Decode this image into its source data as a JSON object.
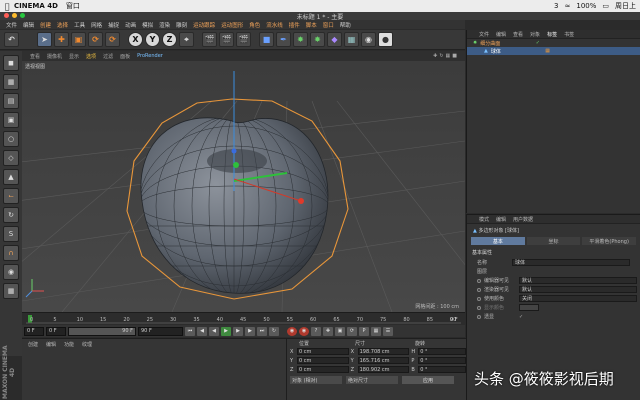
{
  "mac": {
    "app_name": "CINEMA 4D",
    "menu_window": "窗口",
    "battery": "100%",
    "time": "周日上",
    "badge_count": "3"
  },
  "window": {
    "title": "未标题 1 * - 主要"
  },
  "menubar": [
    "文件",
    "编辑",
    "创建",
    "选择",
    "工具",
    "网格",
    "捕捉",
    "动画",
    "模拟",
    "渲染",
    "雕刻",
    "运动跟踪",
    "运动图形",
    "角色",
    "流水线",
    "插件",
    "脚本",
    "窗口",
    "帮助"
  ],
  "viewport": {
    "menu": [
      "查看",
      "摄像机",
      "显示",
      "选项",
      "过滤",
      "面板",
      "ProRender"
    ],
    "label": "透视视图",
    "grid_info": "网格间距 : 100 cm"
  },
  "timeline": {
    "ticks": [
      "0",
      "5",
      "10",
      "15",
      "20",
      "25",
      "30",
      "35",
      "40",
      "45",
      "50",
      "55",
      "60",
      "65",
      "70",
      "75",
      "80",
      "85",
      "90"
    ],
    "end_frame": "0 F",
    "start_field": "0 F",
    "min_field": "0 F",
    "max_field": "90 F",
    "max_field2": "90 F"
  },
  "materials": {
    "menu": [
      "创建",
      "编辑",
      "功能",
      "纹理"
    ],
    "brand": "MAXON CINEMA 4D"
  },
  "coords": {
    "headers": [
      "位置",
      "尺寸",
      "旋转"
    ],
    "rows": [
      {
        "axis": "X",
        "pos": "0 cm",
        "size": "198.708 cm",
        "rot_axis": "H",
        "rot": "0 °"
      },
      {
        "axis": "Y",
        "pos": "0 cm",
        "size": "165.716 cm",
        "rot_axis": "P",
        "rot": "0 °"
      },
      {
        "axis": "Z",
        "pos": "0 cm",
        "size": "180.902 cm",
        "rot_axis": "B",
        "rot": "0 °"
      }
    ],
    "mode": "对象 (相对)",
    "size_mode": "绝对尺寸",
    "apply": "应用"
  },
  "objects": {
    "menu": [
      "文件",
      "编辑",
      "查看",
      "对象",
      "标签",
      "书签"
    ],
    "items": [
      {
        "name": "细分曲面",
        "selected": false
      },
      {
        "name": "球体",
        "selected": true
      }
    ]
  },
  "attributes": {
    "menu": [
      "模式",
      "编辑",
      "用户数据"
    ],
    "object_label": "多边形对象 [球体]",
    "tabs": [
      "基本",
      "坐标",
      "平滑着色(Phong)"
    ],
    "section": "基本属性",
    "rows": [
      {
        "label": "名称",
        "value": "球体"
      },
      {
        "label": "图层",
        "value": ""
      },
      {
        "label": "编辑器可见",
        "value": "默认"
      },
      {
        "label": "渲染器可见",
        "value": "默认"
      },
      {
        "label": "使用颜色",
        "value": "关闭"
      },
      {
        "label": "显示颜色",
        "value": ""
      },
      {
        "label": "透显",
        "value": ""
      }
    ]
  },
  "watermark": "头条 @筱筱影视后期",
  "colors": {
    "selection": "#3d5c86",
    "orange_cage": "#e8963a",
    "mesh": "#5f6670",
    "accent": "#f0a35a"
  }
}
